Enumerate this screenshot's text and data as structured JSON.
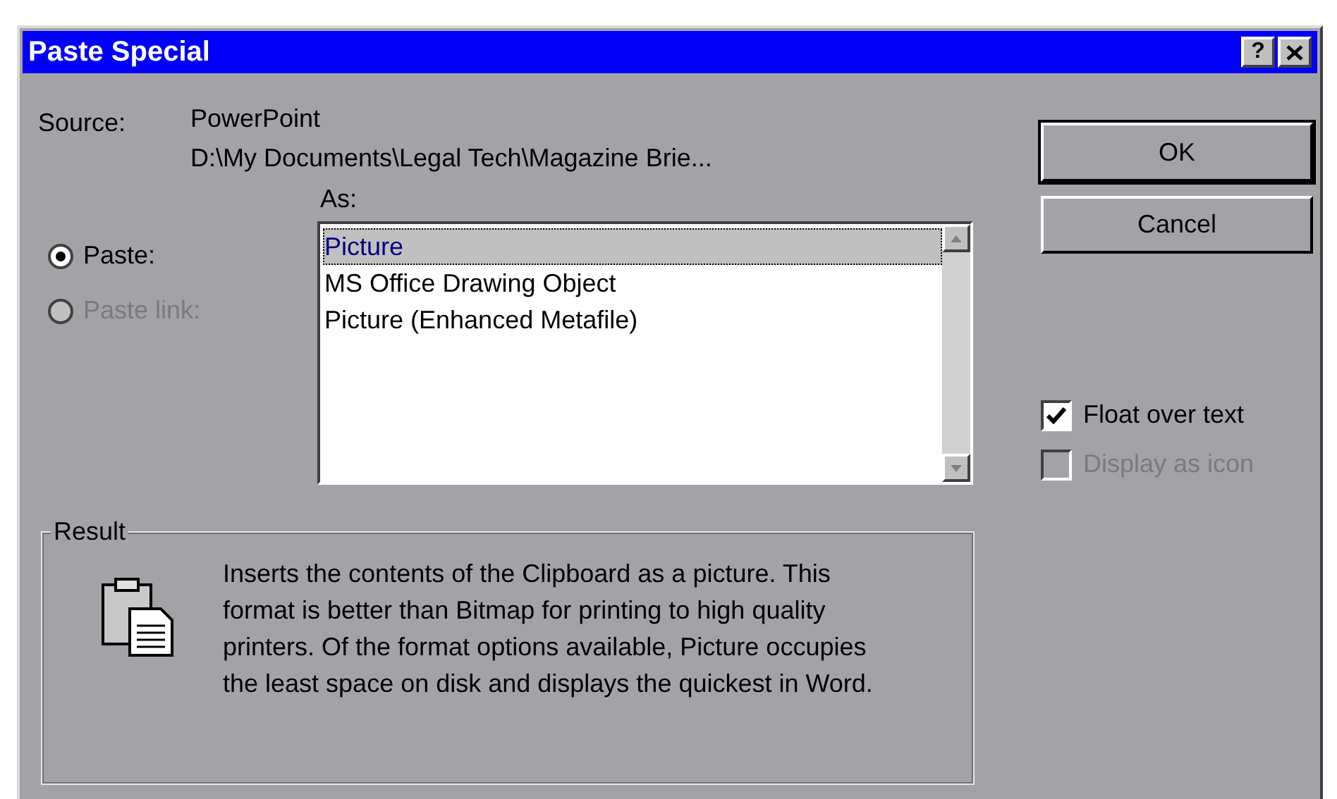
{
  "window": {
    "title": "Paste Special",
    "help_button": "?"
  },
  "source": {
    "label": "Source:",
    "app": "PowerPoint",
    "path": "D:\\My Documents\\Legal Tech\\Magazine Brie..."
  },
  "paste_options": [
    {
      "label": "Paste:",
      "selected": true,
      "disabled": false
    },
    {
      "label": "Paste link:",
      "selected": false,
      "disabled": true
    }
  ],
  "as_list": {
    "label": "As:",
    "items": [
      {
        "label": "Picture",
        "selected": true
      },
      {
        "label": "MS Office Drawing Object",
        "selected": false
      },
      {
        "label": "Picture (Enhanced Metafile)",
        "selected": false
      }
    ]
  },
  "buttons": [
    {
      "label": "OK",
      "default": true
    },
    {
      "label": "Cancel",
      "default": false
    }
  ],
  "options": [
    {
      "label": "Float over text",
      "checked": true,
      "disabled": false
    },
    {
      "label": "Display as icon",
      "checked": false,
      "disabled": true
    }
  ],
  "result": {
    "label": "Result",
    "text": "Inserts the contents of the Clipboard as a picture. This format is better than Bitmap for printing to high quality printers. Of the format options available, Picture occupies the least space on disk and displays the quickest in Word."
  }
}
